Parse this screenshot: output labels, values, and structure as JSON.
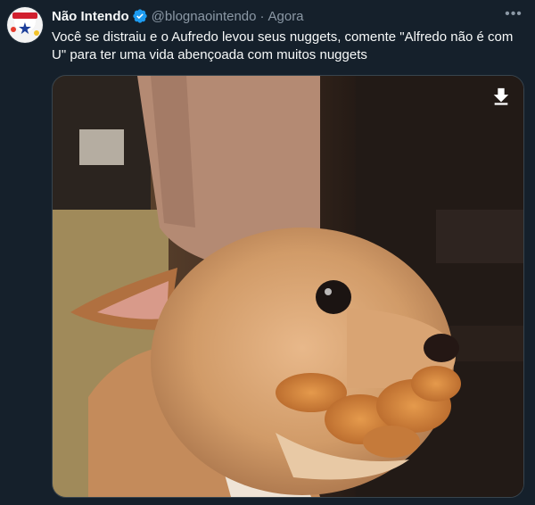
{
  "tweet": {
    "author_name": "Não Intendo",
    "handle": "@blognaointendo",
    "separator": "·",
    "time": "Agora",
    "text": "Você se distraiu e o Aufredo levou seus nuggets, comente \"Alfredo não é com U\" para ter uma vida abençoada com muitos nuggets",
    "more_icon": "more-icon",
    "verified_icon": "verified-badge-icon",
    "media_icon": "download-icon"
  },
  "colors": {
    "background": "#15202b",
    "verified": "#1d9bf0",
    "muted": "#8b98a5",
    "text": "#f7f9f9"
  }
}
